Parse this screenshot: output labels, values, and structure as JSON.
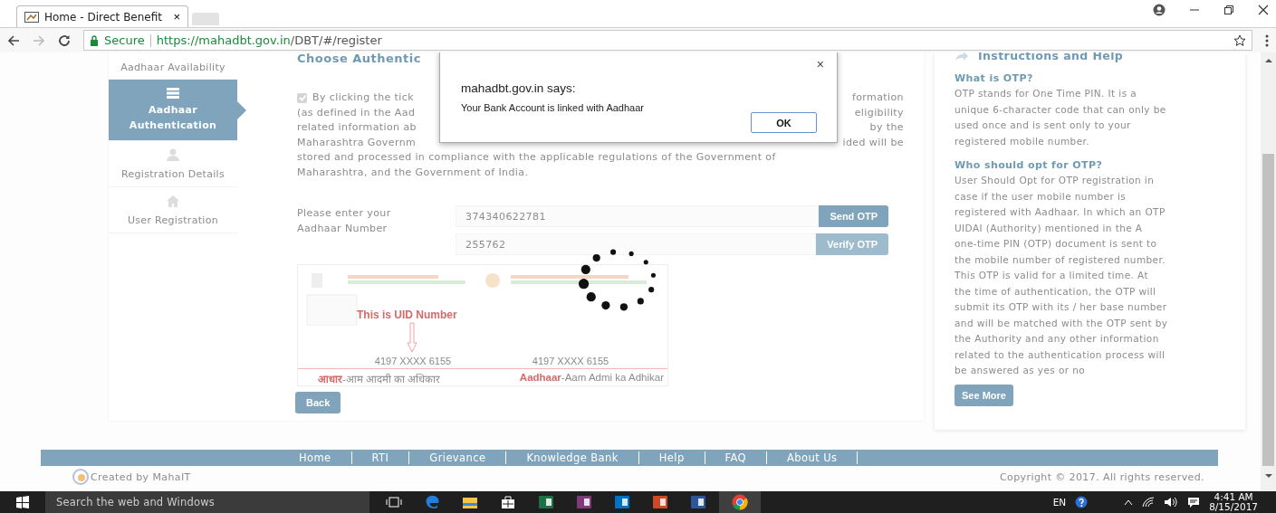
{
  "browser": {
    "tab": {
      "title": "Home - Direct Benefit",
      "close": "×"
    },
    "address": {
      "secure": "Secure",
      "host": "https://mahadbt.gov.in",
      "path": "/DBT/#/register"
    }
  },
  "sidebar": {
    "items": [
      {
        "label": "Aadhaar Availability",
        "selected": false
      },
      {
        "label": "Aadhaar Authentication",
        "selected": true
      },
      {
        "label": "Registration Details",
        "selected": false
      },
      {
        "label": "User Registration",
        "selected": false
      }
    ]
  },
  "main": {
    "heading": "Choose Authentic",
    "consent": {
      "checked": true,
      "lines": [
        [
          "By clicking the tick",
          "formation"
        ],
        [
          "(as defined in the Aad",
          "eligibility"
        ],
        [
          "related information ab",
          "by the"
        ],
        [
          "Maharashtra Governm",
          "ided will be"
        ]
      ],
      "tail_lines": [
        "stored and processed in compliance with the applicable regulations of the Government of",
        "Maharashtra, and the Government of India."
      ]
    },
    "form": {
      "label": "Please enter your Aadhaar Number",
      "aadhaar_value": "374340622781",
      "send_button": "Send OTP",
      "otp_value": "255762",
      "verify_button": "Verify OTP",
      "verify_disabled": true
    },
    "card": {
      "uid_caption": "This is UID Number",
      "numbers": [
        "4197 XXXX 6155",
        "4197 XXXX 6155"
      ],
      "mottos": [
        {
          "highlight": "आधार",
          "rest": "-आम आदमी का अधिकार"
        },
        {
          "highlight": "Aadhaar",
          "rest": "-Aam Admi ka Adhikar"
        }
      ]
    },
    "back_button": "Back"
  },
  "help": {
    "title": "Instructions and Help",
    "sections": [
      {
        "question": "What is OTP?",
        "answer": "OTP stands for One Time PIN. It is a unique 6-character code that can only be used once and is sent only to your registered mobile number."
      },
      {
        "question": "Who should opt for OTP?",
        "answer": "User Should Opt for OTP registration in case if the user mobile number is registered with Aadhaar. In which an OTP UIDAI (Authority) mentioned in the A one-time PIN (OTP) document is sent to the mobile number of registered number. This OTP is valid for a limited time. At the time of authentication, the OTP will submit its OTP with its / her base number and will be matched with the OTP sent by the Authority and any other information related to the authentication process will be answered as yes or no"
      }
    ],
    "button": "See More"
  },
  "footer": {
    "links": [
      "Home",
      "RTI",
      "Grievance",
      "Knowledge Bank",
      "Help",
      "FAQ",
      "About Us"
    ],
    "created_by": "Created by MahaIT",
    "copyright": "Copyright © 2017. All rights reserved."
  },
  "dialog": {
    "title": "mahadbt.gov.in says:",
    "message": "Your Bank Account is linked with Aadhaar",
    "ok": "OK",
    "close": "×"
  },
  "taskbar": {
    "search": "Search the web and Windows",
    "language": "EN",
    "time": "4:41 AM",
    "date": "8/15/2017"
  }
}
